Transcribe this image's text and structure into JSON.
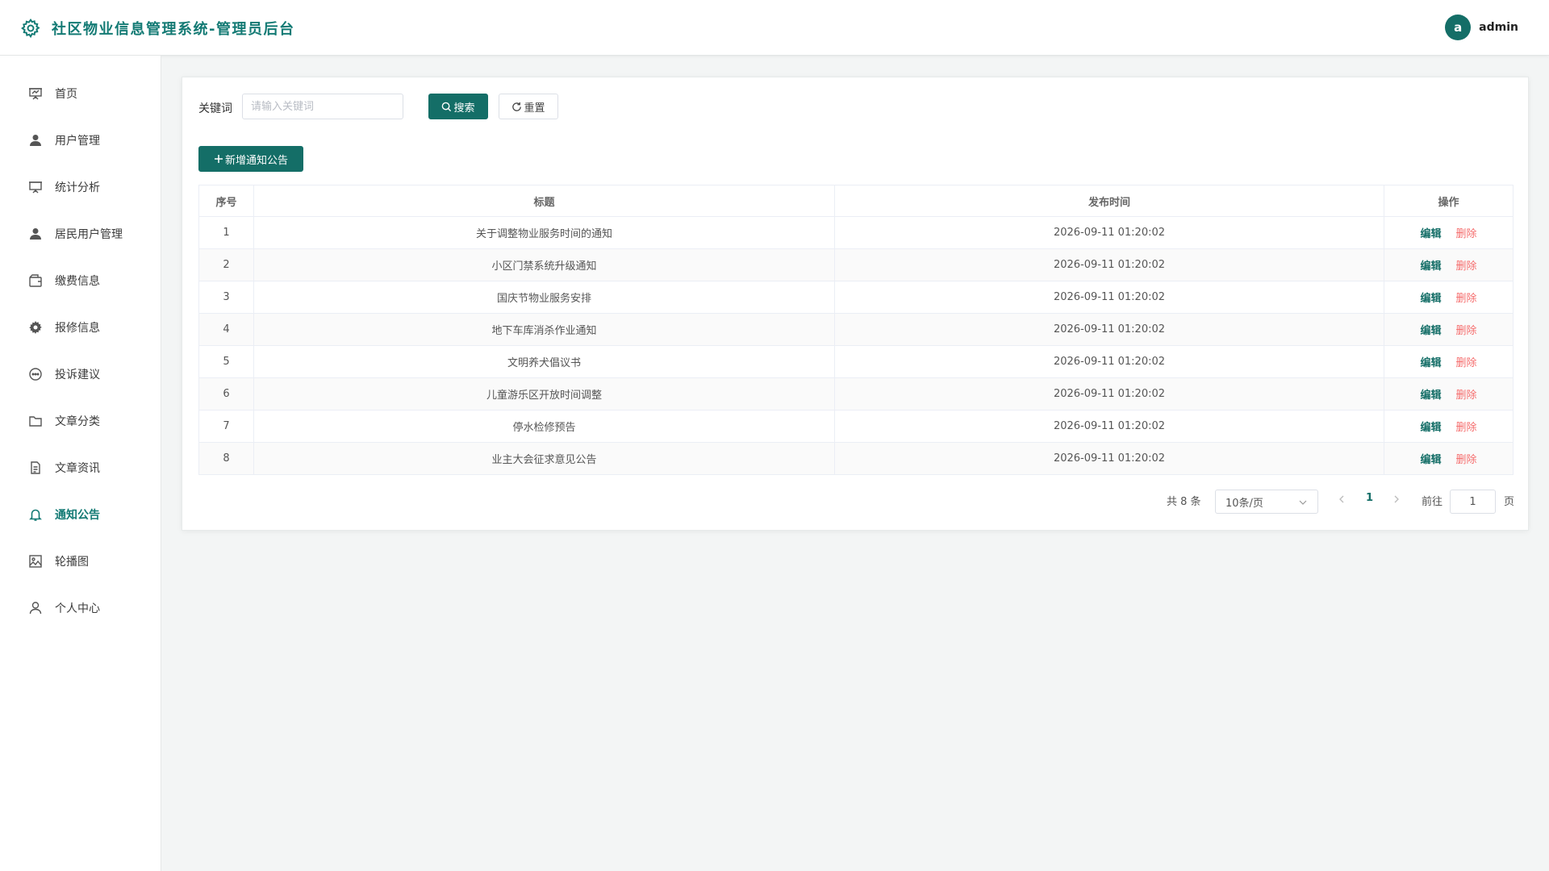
{
  "header": {
    "title": "社区物业信息管理系统-管理员后台",
    "avatar_letter": "a",
    "username": "admin"
  },
  "sidebar": {
    "items": [
      {
        "label": "首页",
        "icon": "presentation-icon"
      },
      {
        "label": "用户管理",
        "icon": "user-icon"
      },
      {
        "label": "统计分析",
        "icon": "presentation-icon"
      },
      {
        "label": "居民用户管理",
        "icon": "user-icon"
      },
      {
        "label": "缴费信息",
        "icon": "wallet-icon"
      },
      {
        "label": "报修信息",
        "icon": "gear-icon"
      },
      {
        "label": "投诉建议",
        "icon": "chat-icon"
      },
      {
        "label": "文章分类",
        "icon": "folder-icon"
      },
      {
        "label": "文章资讯",
        "icon": "document-icon"
      },
      {
        "label": "通知公告",
        "icon": "bell-icon"
      },
      {
        "label": "轮播图",
        "icon": "image-icon"
      },
      {
        "label": "个人中心",
        "icon": "user-outline-icon"
      }
    ],
    "active_index": 9
  },
  "search": {
    "label": "关键词",
    "placeholder": "请输入关键词",
    "value": "",
    "search_button": "搜索",
    "reset_button": "重置"
  },
  "toolbar": {
    "add_button": "新增通知公告"
  },
  "table": {
    "columns": [
      "序号",
      "标题",
      "发布时间",
      "操作"
    ],
    "rows": [
      {
        "index": "1",
        "title": "关于调整物业服务时间的通知",
        "time": "2026-09-11 01:20:02"
      },
      {
        "index": "2",
        "title": "小区门禁系统升级通知",
        "time": "2026-09-11 01:20:02"
      },
      {
        "index": "3",
        "title": "国庆节物业服务安排",
        "time": "2026-09-11 01:20:02"
      },
      {
        "index": "4",
        "title": "地下车库消杀作业通知",
        "time": "2026-09-11 01:20:02"
      },
      {
        "index": "5",
        "title": "文明养犬倡议书",
        "time": "2026-09-11 01:20:02"
      },
      {
        "index": "6",
        "title": "儿童游乐区开放时间调整",
        "time": "2026-09-11 01:20:02"
      },
      {
        "index": "7",
        "title": "停水检修预告",
        "time": "2026-09-11 01:20:02"
      },
      {
        "index": "8",
        "title": "业主大会征求意见公告",
        "time": "2026-09-11 01:20:02"
      }
    ],
    "edit_label": "编辑",
    "delete_label": "删除"
  },
  "pagination": {
    "total_text": "共 8 条",
    "page_size": "10条/页",
    "current_page": "1",
    "goto_label": "前往",
    "goto_value": "1",
    "page_suffix": "页"
  },
  "colors": {
    "primary": "#146e67",
    "danger": "#f56c6c",
    "background": "#f3f5f5"
  }
}
